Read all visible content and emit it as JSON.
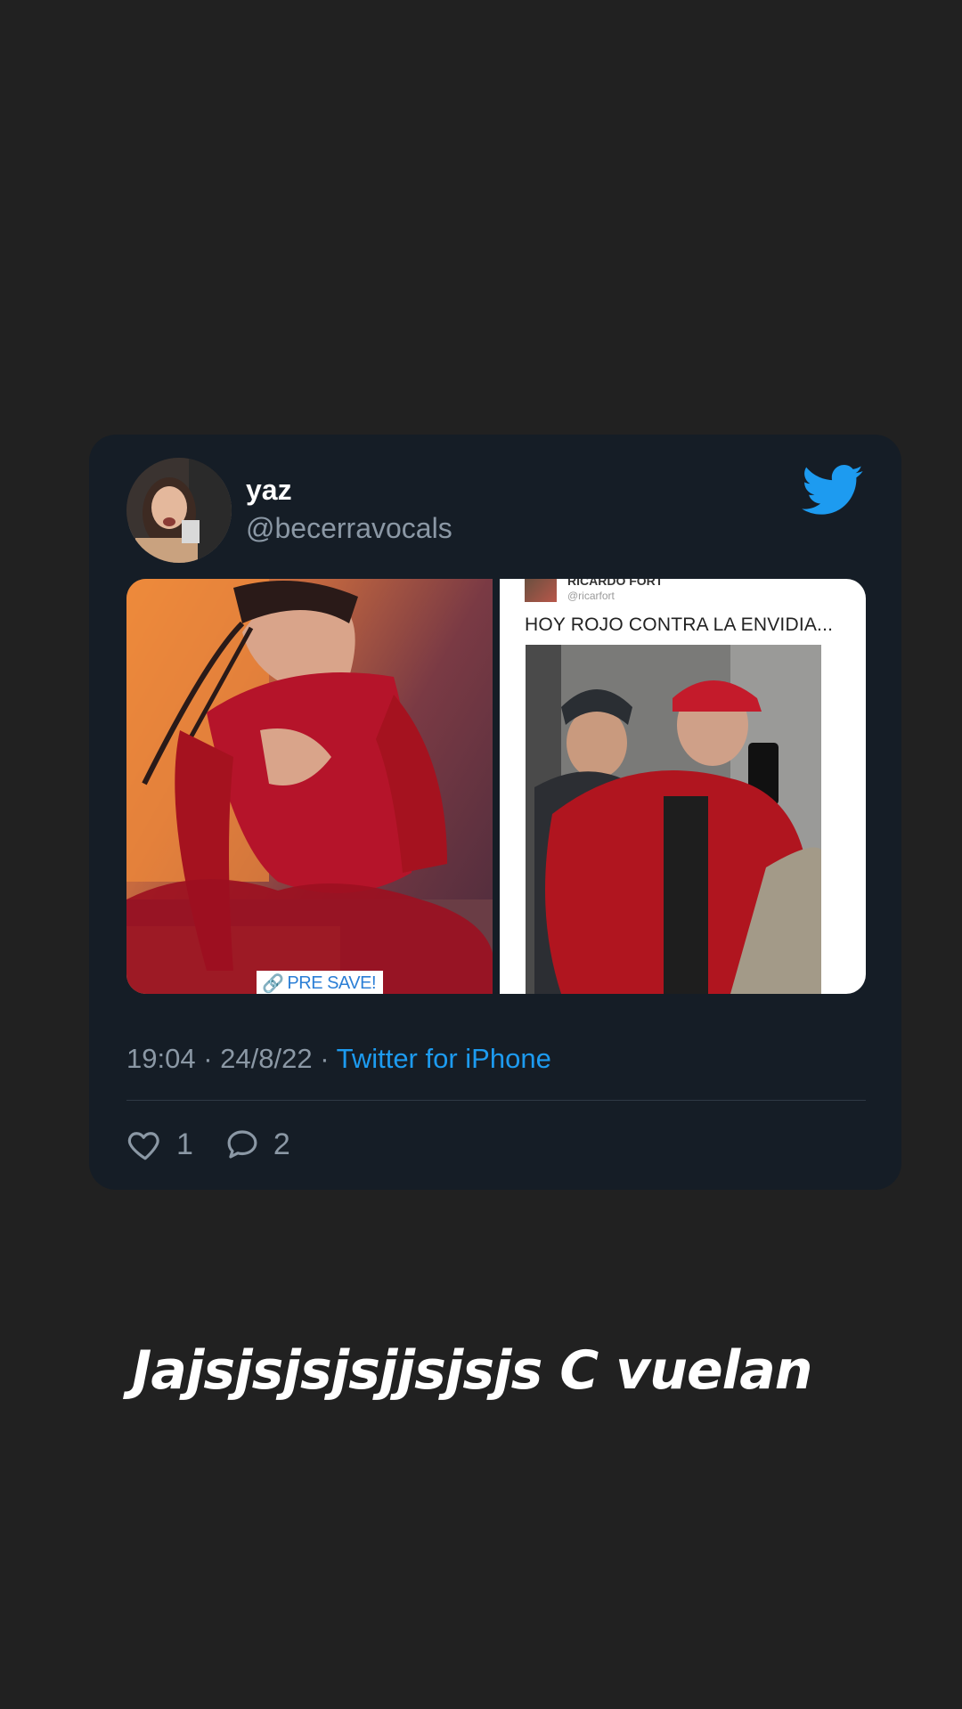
{
  "tweet": {
    "display_name": "yaz",
    "handle": "@becerravocals",
    "time": "19:04",
    "date": "24/8/22",
    "source": "Twitter for iPhone",
    "likes": "1",
    "replies": "2",
    "brand_color": "#1d9bf0"
  },
  "media": {
    "left_badge": "PRE SAVE!",
    "embed": {
      "name": "RICARDO FORT",
      "handle": "@ricarfort",
      "text": "HOY ROJO CONTRA LA ENVIDIA..."
    }
  },
  "caption": "Jajsjsjsjsjjsjsjs C vuelan",
  "icons": {
    "brand": "twitter-bird-icon",
    "like": "heart-icon",
    "reply": "speech-bubble-icon",
    "badge": "link-icon"
  }
}
